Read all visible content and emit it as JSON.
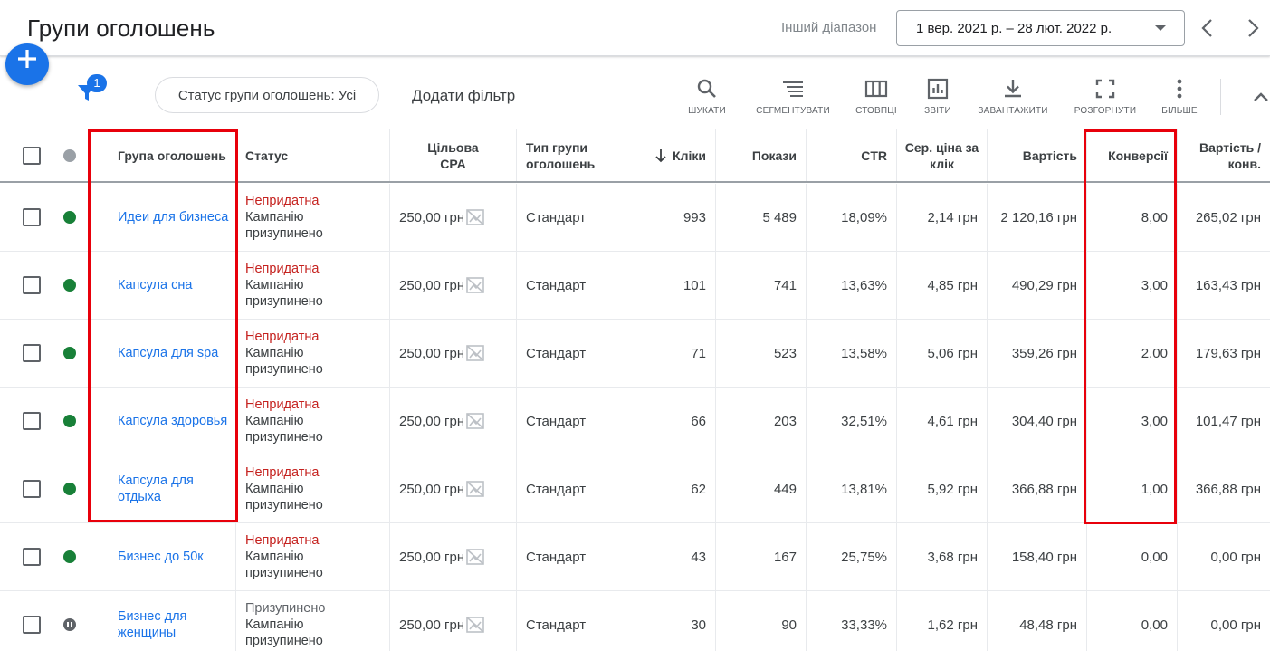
{
  "header": {
    "title": "Групи оголошень",
    "range_label": "Інший діапазон",
    "date_range": "1 вер. 2021 р. – 28 лют. 2022 р."
  },
  "toolbar": {
    "filter_count": "1",
    "status_chip": "Статус групи оголошень: Усі",
    "add_filter": "Додати фільтр",
    "tools": [
      {
        "label": "ШУКАТИ",
        "icon": "search-icon"
      },
      {
        "label": "СЕГМЕНТУВАТИ",
        "icon": "segment-icon"
      },
      {
        "label": "СТОВПЦІ",
        "icon": "columns-icon"
      },
      {
        "label": "ЗВІТИ",
        "icon": "reports-icon"
      },
      {
        "label": "ЗАВАНТАЖИТИ",
        "icon": "download-icon"
      },
      {
        "label": "РОЗГОРНУТИ",
        "icon": "expand-icon"
      },
      {
        "label": "БІЛЬШЕ",
        "icon": "more-vert-icon"
      }
    ]
  },
  "table": {
    "headers": {
      "group": "Група оголошень",
      "status": "Статус",
      "target_cpa": "Цільова CPA",
      "type": "Тип групи оголошень",
      "clicks": "Кліки",
      "impressions": "Покази",
      "ctr": "CTR",
      "avg_cpc": "Сер. ціна за клік",
      "cost": "Вартість",
      "conversions": "Конверсії",
      "cost_per_conv": "Вартість / конв."
    },
    "rows": [
      {
        "state": "green",
        "name": "Идеи для бизнеса",
        "status1": "Непридатна",
        "status1_style": "red",
        "status2": "Кампанію",
        "status3": "призупинено",
        "cpa": "250,00 грн",
        "type": "Стандарт",
        "clicks": "993",
        "impressions": "5 489",
        "ctr": "18,09%",
        "cpc": "2,14 грн",
        "cost": "2 120,16 грн",
        "conv": "8,00",
        "cpconv": "265,02 грн"
      },
      {
        "state": "green",
        "name": "Капсула сна",
        "status1": "Непридатна",
        "status1_style": "red",
        "status2": "Кампанію",
        "status3": "призупинено",
        "cpa": "250,00 грн",
        "type": "Стандарт",
        "clicks": "101",
        "impressions": "741",
        "ctr": "13,63%",
        "cpc": "4,85 грн",
        "cost": "490,29 грн",
        "conv": "3,00",
        "cpconv": "163,43 грн"
      },
      {
        "state": "green",
        "name": "Капсула для spa",
        "status1": "Непридатна",
        "status1_style": "red",
        "status2": "Кампанію",
        "status3": "призупинено",
        "cpa": "250,00 грн",
        "type": "Стандарт",
        "clicks": "71",
        "impressions": "523",
        "ctr": "13,58%",
        "cpc": "5,06 грн",
        "cost": "359,26 грн",
        "conv": "2,00",
        "cpconv": "179,63 грн"
      },
      {
        "state": "green",
        "name": "Капсула здоровья",
        "status1": "Непридатна",
        "status1_style": "red",
        "status2": "Кампанію",
        "status3": "призупинено",
        "cpa": "250,00 грн",
        "type": "Стандарт",
        "clicks": "66",
        "impressions": "203",
        "ctr": "32,51%",
        "cpc": "4,61 грн",
        "cost": "304,40 грн",
        "conv": "3,00",
        "cpconv": "101,47 грн"
      },
      {
        "state": "green",
        "name": "Капсула для отдыха",
        "status1": "Непридатна",
        "status1_style": "red",
        "status2": "Кампанію",
        "status3": "призупинено",
        "cpa": "250,00 грн",
        "type": "Стандарт",
        "clicks": "62",
        "impressions": "449",
        "ctr": "13,81%",
        "cpc": "5,92 грн",
        "cost": "366,88 грн",
        "conv": "1,00",
        "cpconv": "366,88 грн"
      },
      {
        "state": "green",
        "name": "Бизнес до 50к",
        "status1": "Непридатна",
        "status1_style": "red",
        "status2": "Кампанію",
        "status3": "призупинено",
        "cpa": "250,00 грн",
        "type": "Стандарт",
        "clicks": "43",
        "impressions": "167",
        "ctr": "25,75%",
        "cpc": "3,68 грн",
        "cost": "158,40 грн",
        "conv": "0,00",
        "cpconv": "0,00 грн"
      },
      {
        "state": "paused",
        "name": "Бизнес для женщины",
        "status1": "Призупинено",
        "status1_style": "grey",
        "status2": "Кампанію",
        "status3": "призупинено",
        "cpa": "250,00 грн",
        "type": "Стандарт",
        "clicks": "30",
        "impressions": "90",
        "ctr": "33,33%",
        "cpc": "1,62 грн",
        "cost": "48,48 грн",
        "conv": "0,00",
        "cpconv": "0,00 грн"
      }
    ]
  },
  "colors": {
    "link": "#1a73e8",
    "ineligible": "#c5221f",
    "enabled_dot": "#188038",
    "highlight": "#e8000b"
  }
}
